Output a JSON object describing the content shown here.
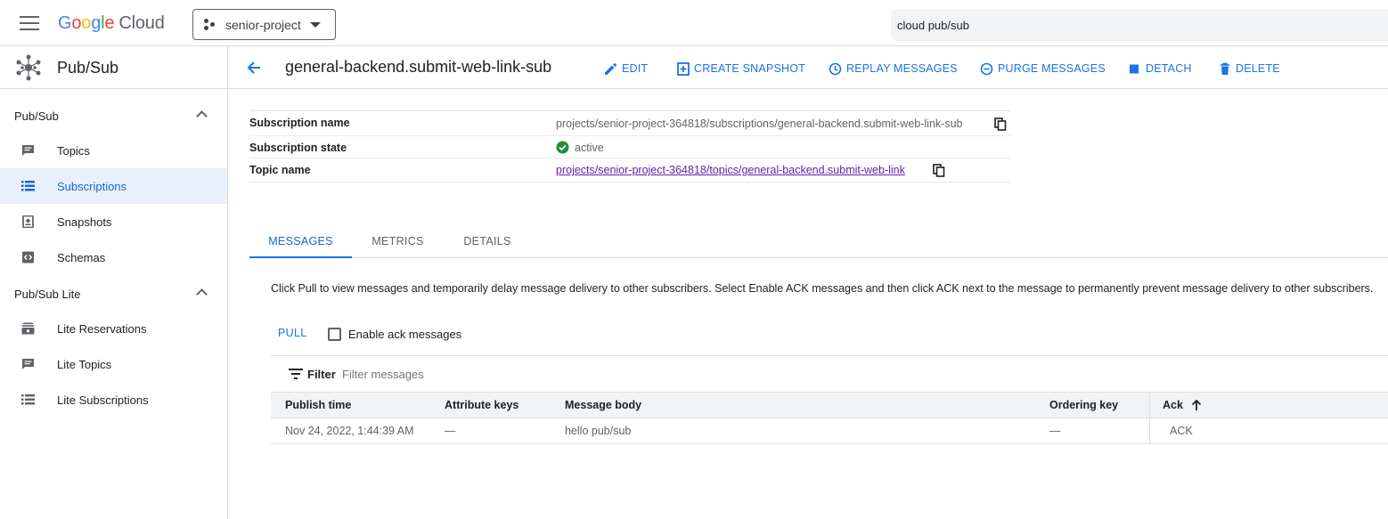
{
  "topbar": {
    "brand": [
      "G",
      "o",
      "o",
      "g",
      "l",
      "e"
    ],
    "brand_suffix": "Cloud",
    "project": "senior-project",
    "search_value": "cloud pub/sub"
  },
  "sidebar": {
    "product": "Pub/Sub",
    "sections": [
      {
        "label": "Pub/Sub",
        "items": [
          {
            "label": "Topics",
            "icon": "topics-icon"
          },
          {
            "label": "Subscriptions",
            "icon": "subscriptions-icon",
            "active": true
          },
          {
            "label": "Snapshots",
            "icon": "snapshots-icon"
          },
          {
            "label": "Schemas",
            "icon": "schemas-icon"
          }
        ]
      },
      {
        "label": "Pub/Sub Lite",
        "items": [
          {
            "label": "Lite Reservations",
            "icon": "lite-reservations-icon"
          },
          {
            "label": "Lite Topics",
            "icon": "lite-topics-icon"
          },
          {
            "label": "Lite Subscriptions",
            "icon": "lite-subscriptions-icon"
          }
        ]
      }
    ]
  },
  "header": {
    "title": "general-backend.submit-web-link-sub",
    "actions": {
      "edit": "EDIT",
      "create_snapshot": "CREATE SNAPSHOT",
      "replay": "REPLAY MESSAGES",
      "purge": "PURGE MESSAGES",
      "detach": "DETACH",
      "delete": "DELETE"
    }
  },
  "details": {
    "subscription_name_label": "Subscription name",
    "subscription_name": "projects/senior-project-364818/subscriptions/general-backend.submit-web-link-sub",
    "subscription_state_label": "Subscription state",
    "subscription_state": "active",
    "topic_name_label": "Topic name",
    "topic_name": "projects/senior-project-364818/topics/general-backend.submit-web-link"
  },
  "tabs": [
    "MESSAGES",
    "METRICS",
    "DETAILS"
  ],
  "messages": {
    "description": "Click Pull to view messages and temporarily delay message delivery to other subscribers. Select Enable ACK messages and then click ACK next to the message to permanently prevent message delivery to other subscribers.",
    "pull": "PULL",
    "enable_ack": "Enable ack messages",
    "filter_label": "Filter",
    "filter_placeholder": "Filter messages",
    "columns": [
      "Publish time",
      "Attribute keys",
      "Message body",
      "Ordering key",
      "Ack"
    ],
    "rows": [
      {
        "publish_time": "Nov 24, 2022, 1:44:39 AM",
        "attribute_keys": "—",
        "message_body": "hello pub/sub",
        "ordering_key": "—",
        "ack": "ACK"
      }
    ]
  },
  "colors": {
    "accent": "#1a73e8",
    "active_bg": "#e8f0fe",
    "link_visited": "#681da8",
    "status_ok": "#1e8e3e"
  }
}
